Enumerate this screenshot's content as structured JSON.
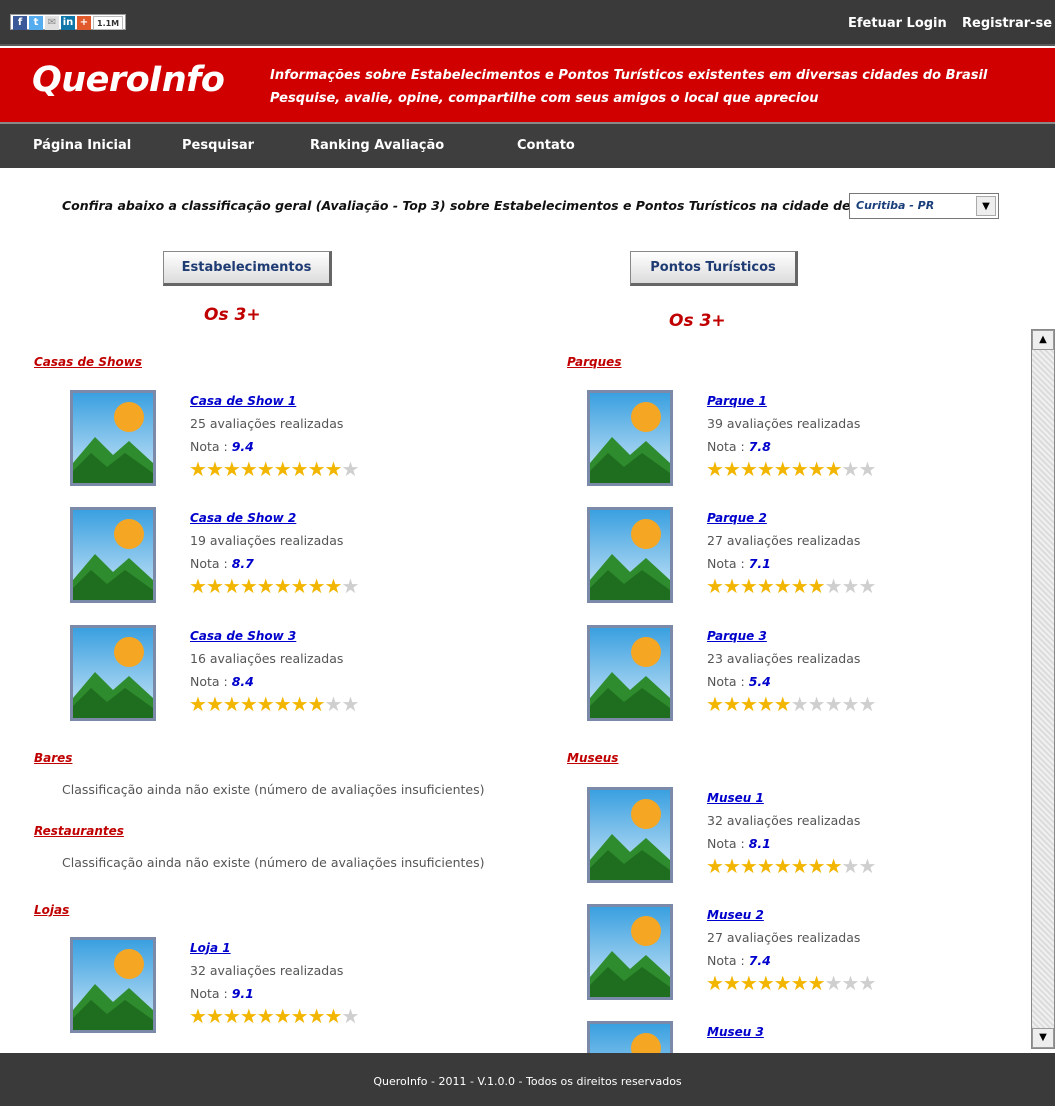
{
  "topbar": {
    "share_count": "1.1M",
    "login": "Efetuar Login",
    "register": "Registrar-se"
  },
  "header": {
    "logo": "QueroInfo",
    "tagline1": "Informações sobre Estabelecimentos e Pontos Turísticos existentes em diversas cidades do Brasil",
    "tagline2": "Pesquise, avalie, opine, compartilhe com seus amigos o local que apreciou"
  },
  "nav": {
    "items": [
      "Página Inicial",
      "Pesquisar",
      "Ranking Avaliação",
      "Contato"
    ]
  },
  "main": {
    "intro": "Confira abaixo a classificação geral (Avaliação - Top 3) sobre Estabelecimentos e Pontos Turísticos na cidade de",
    "city_select": "Curitiba - PR",
    "btn_estabelecimentos": "Estabelecimentos",
    "btn_pontos": "Pontos Turísticos",
    "top3_label": "Os 3+",
    "count_suffix": "avaliações realizadas",
    "nota_label": "Nota :",
    "no_class": "Classificação ainda não existe (número de avaliações insuficientes)"
  },
  "left": {
    "casas_title": "Casas de Shows",
    "casas": [
      {
        "name": "Casa de Show 1",
        "count": "25 avaliações realizadas",
        "nota": "9.4",
        "stars": 9
      },
      {
        "name": "Casa de Show 2",
        "count": "19 avaliações realizadas",
        "nota": "8.7",
        "stars": 9
      },
      {
        "name": "Casa de Show 3",
        "count": "16 avaliações realizadas",
        "nota": "8.4",
        "stars": 8
      }
    ],
    "bares_title": "Bares",
    "bares_msg": "Classificação ainda não existe (número de avaliações insuficientes)",
    "rest_title": "Restaurantes",
    "rest_msg": "Classificação ainda não existe (número de avaliações insuficientes)",
    "lojas_title": "Lojas",
    "lojas": [
      {
        "name": "Loja 1",
        "count": "32 avaliações realizadas",
        "nota": "9.1",
        "stars": 9
      }
    ]
  },
  "right": {
    "parques_title": "Parques",
    "parques": [
      {
        "name": "Parque 1",
        "count": "39 avaliações realizadas",
        "nota": "7.8",
        "stars": 8
      },
      {
        "name": "Parque 2",
        "count": "27 avaliações realizadas",
        "nota": "7.1",
        "stars": 7
      },
      {
        "name": "Parque 3",
        "count": "23 avaliações realizadas",
        "nota": "5.4",
        "stars": 5
      }
    ],
    "museus_title": "Museus",
    "museus": [
      {
        "name": "Museu 1",
        "count": "32 avaliações realizadas",
        "nota": "8.1",
        "stars": 8
      },
      {
        "name": "Museu 2",
        "count": "27 avaliações realizadas",
        "nota": "7.4",
        "stars": 7
      },
      {
        "name": "Museu 3"
      }
    ]
  },
  "footer": {
    "text": "QueroInfo - 2011 - V.1.0.0 - Todos os direitos reservados"
  },
  "colors": {
    "header_red": "#d00000",
    "dark_bar": "#3a3a3a",
    "star_gold": "#f2b600",
    "link_blue": "#0000cc"
  }
}
